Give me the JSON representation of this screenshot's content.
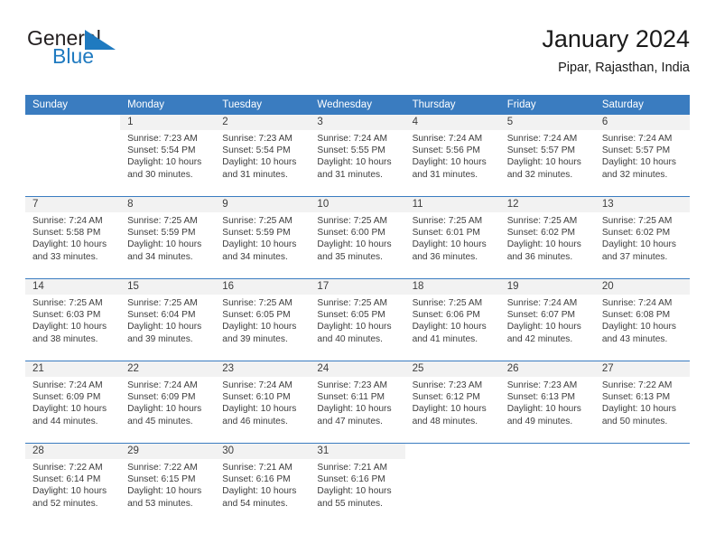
{
  "brand": {
    "name_part1": "General",
    "name_part2": "Blue",
    "flag_icon": "triangle-flag-icon",
    "accent_color": "#1f7ac0"
  },
  "header": {
    "title": "January 2024",
    "location": "Pipar, Rajasthan, India",
    "header_bg_color": "#3a7cc0",
    "daynum_bg_color": "#f2f2f2"
  },
  "weekday_headers": [
    "Sunday",
    "Monday",
    "Tuesday",
    "Wednesday",
    "Thursday",
    "Friday",
    "Saturday"
  ],
  "weeks": [
    [
      {
        "day": "",
        "sunrise": "",
        "sunset": "",
        "daylight": "",
        "empty": true
      },
      {
        "day": "1",
        "sunrise": "Sunrise: 7:23 AM",
        "sunset": "Sunset: 5:54 PM",
        "daylight": "Daylight: 10 hours and 30 minutes."
      },
      {
        "day": "2",
        "sunrise": "Sunrise: 7:23 AM",
        "sunset": "Sunset: 5:54 PM",
        "daylight": "Daylight: 10 hours and 31 minutes."
      },
      {
        "day": "3",
        "sunrise": "Sunrise: 7:24 AM",
        "sunset": "Sunset: 5:55 PM",
        "daylight": "Daylight: 10 hours and 31 minutes."
      },
      {
        "day": "4",
        "sunrise": "Sunrise: 7:24 AM",
        "sunset": "Sunset: 5:56 PM",
        "daylight": "Daylight: 10 hours and 31 minutes."
      },
      {
        "day": "5",
        "sunrise": "Sunrise: 7:24 AM",
        "sunset": "Sunset: 5:57 PM",
        "daylight": "Daylight: 10 hours and 32 minutes."
      },
      {
        "day": "6",
        "sunrise": "Sunrise: 7:24 AM",
        "sunset": "Sunset: 5:57 PM",
        "daylight": "Daylight: 10 hours and 32 minutes."
      }
    ],
    [
      {
        "day": "7",
        "sunrise": "Sunrise: 7:24 AM",
        "sunset": "Sunset: 5:58 PM",
        "daylight": "Daylight: 10 hours and 33 minutes."
      },
      {
        "day": "8",
        "sunrise": "Sunrise: 7:25 AM",
        "sunset": "Sunset: 5:59 PM",
        "daylight": "Daylight: 10 hours and 34 minutes."
      },
      {
        "day": "9",
        "sunrise": "Sunrise: 7:25 AM",
        "sunset": "Sunset: 5:59 PM",
        "daylight": "Daylight: 10 hours and 34 minutes."
      },
      {
        "day": "10",
        "sunrise": "Sunrise: 7:25 AM",
        "sunset": "Sunset: 6:00 PM",
        "daylight": "Daylight: 10 hours and 35 minutes."
      },
      {
        "day": "11",
        "sunrise": "Sunrise: 7:25 AM",
        "sunset": "Sunset: 6:01 PM",
        "daylight": "Daylight: 10 hours and 36 minutes."
      },
      {
        "day": "12",
        "sunrise": "Sunrise: 7:25 AM",
        "sunset": "Sunset: 6:02 PM",
        "daylight": "Daylight: 10 hours and 36 minutes."
      },
      {
        "day": "13",
        "sunrise": "Sunrise: 7:25 AM",
        "sunset": "Sunset: 6:02 PM",
        "daylight": "Daylight: 10 hours and 37 minutes."
      }
    ],
    [
      {
        "day": "14",
        "sunrise": "Sunrise: 7:25 AM",
        "sunset": "Sunset: 6:03 PM",
        "daylight": "Daylight: 10 hours and 38 minutes."
      },
      {
        "day": "15",
        "sunrise": "Sunrise: 7:25 AM",
        "sunset": "Sunset: 6:04 PM",
        "daylight": "Daylight: 10 hours and 39 minutes."
      },
      {
        "day": "16",
        "sunrise": "Sunrise: 7:25 AM",
        "sunset": "Sunset: 6:05 PM",
        "daylight": "Daylight: 10 hours and 39 minutes."
      },
      {
        "day": "17",
        "sunrise": "Sunrise: 7:25 AM",
        "sunset": "Sunset: 6:05 PM",
        "daylight": "Daylight: 10 hours and 40 minutes."
      },
      {
        "day": "18",
        "sunrise": "Sunrise: 7:25 AM",
        "sunset": "Sunset: 6:06 PM",
        "daylight": "Daylight: 10 hours and 41 minutes."
      },
      {
        "day": "19",
        "sunrise": "Sunrise: 7:24 AM",
        "sunset": "Sunset: 6:07 PM",
        "daylight": "Daylight: 10 hours and 42 minutes."
      },
      {
        "day": "20",
        "sunrise": "Sunrise: 7:24 AM",
        "sunset": "Sunset: 6:08 PM",
        "daylight": "Daylight: 10 hours and 43 minutes."
      }
    ],
    [
      {
        "day": "21",
        "sunrise": "Sunrise: 7:24 AM",
        "sunset": "Sunset: 6:09 PM",
        "daylight": "Daylight: 10 hours and 44 minutes."
      },
      {
        "day": "22",
        "sunrise": "Sunrise: 7:24 AM",
        "sunset": "Sunset: 6:09 PM",
        "daylight": "Daylight: 10 hours and 45 minutes."
      },
      {
        "day": "23",
        "sunrise": "Sunrise: 7:24 AM",
        "sunset": "Sunset: 6:10 PM",
        "daylight": "Daylight: 10 hours and 46 minutes."
      },
      {
        "day": "24",
        "sunrise": "Sunrise: 7:23 AM",
        "sunset": "Sunset: 6:11 PM",
        "daylight": "Daylight: 10 hours and 47 minutes."
      },
      {
        "day": "25",
        "sunrise": "Sunrise: 7:23 AM",
        "sunset": "Sunset: 6:12 PM",
        "daylight": "Daylight: 10 hours and 48 minutes."
      },
      {
        "day": "26",
        "sunrise": "Sunrise: 7:23 AM",
        "sunset": "Sunset: 6:13 PM",
        "daylight": "Daylight: 10 hours and 49 minutes."
      },
      {
        "day": "27",
        "sunrise": "Sunrise: 7:22 AM",
        "sunset": "Sunset: 6:13 PM",
        "daylight": "Daylight: 10 hours and 50 minutes."
      }
    ],
    [
      {
        "day": "28",
        "sunrise": "Sunrise: 7:22 AM",
        "sunset": "Sunset: 6:14 PM",
        "daylight": "Daylight: 10 hours and 52 minutes."
      },
      {
        "day": "29",
        "sunrise": "Sunrise: 7:22 AM",
        "sunset": "Sunset: 6:15 PM",
        "daylight": "Daylight: 10 hours and 53 minutes."
      },
      {
        "day": "30",
        "sunrise": "Sunrise: 7:21 AM",
        "sunset": "Sunset: 6:16 PM",
        "daylight": "Daylight: 10 hours and 54 minutes."
      },
      {
        "day": "31",
        "sunrise": "Sunrise: 7:21 AM",
        "sunset": "Sunset: 6:16 PM",
        "daylight": "Daylight: 10 hours and 55 minutes."
      },
      {
        "day": "",
        "sunrise": "",
        "sunset": "",
        "daylight": "",
        "empty": true
      },
      {
        "day": "",
        "sunrise": "",
        "sunset": "",
        "daylight": "",
        "empty": true
      },
      {
        "day": "",
        "sunrise": "",
        "sunset": "",
        "daylight": "",
        "empty": true
      }
    ]
  ]
}
